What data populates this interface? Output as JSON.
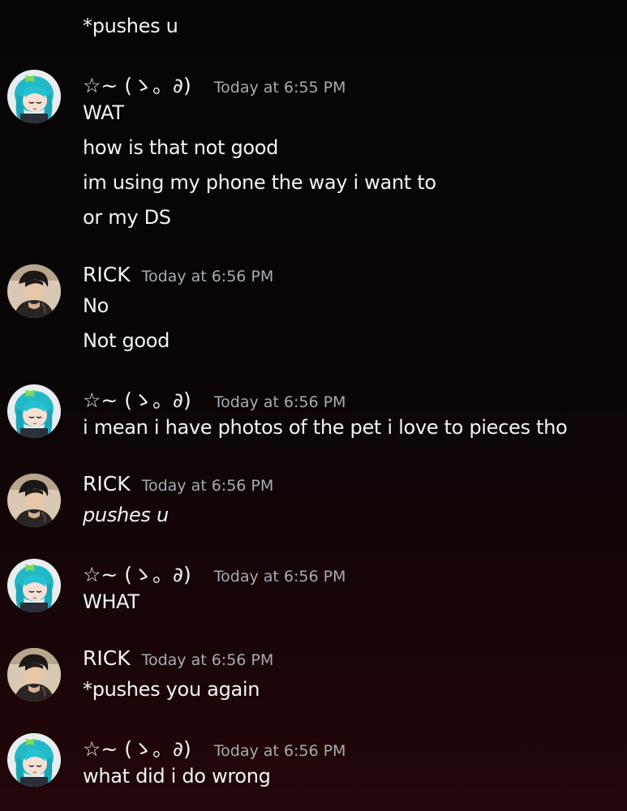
{
  "users": {
    "miku": "☆~ (ゝ。∂)",
    "rick": "RICK"
  },
  "top_line": "*pushes u",
  "groups": [
    {
      "author": "☆~ (ゝ。∂)",
      "time": "Today at 6:55 PM",
      "lines": [
        "WAT",
        "how is that not good",
        "im using my phone the way i want to",
        "or my DS"
      ]
    },
    {
      "author": "RICK",
      "time": "Today at 6:56 PM",
      "lines": [
        "No",
        "Not good"
      ]
    },
    {
      "author": "☆~ (ゝ。∂)",
      "time": "Today at 6:56 PM",
      "lines": [
        "i mean i have photos of the pet i love to pieces tho"
      ]
    },
    {
      "author": "RICK",
      "time": "Today at 6:56 PM",
      "lines": [
        "pushes u"
      ]
    },
    {
      "author": "☆~ (ゝ。∂)",
      "time": "Today at 6:56 PM",
      "lines": [
        "WHAT"
      ]
    },
    {
      "author": "RICK",
      "time": "Today at 6:56 PM",
      "lines": [
        "*pushes you again"
      ]
    },
    {
      "author": "☆~ (ゝ。∂)",
      "time": "Today at 6:56 PM",
      "lines": [
        "what did i do wrong"
      ]
    }
  ],
  "colors": {
    "text": "#f2f3f5",
    "timestamp": "#a8aab4",
    "background": "#0a0506"
  },
  "icons": {
    "miku_avatar": "anime-teal-hair-avatar",
    "rick_avatar": "dark-hair-man-avatar"
  }
}
